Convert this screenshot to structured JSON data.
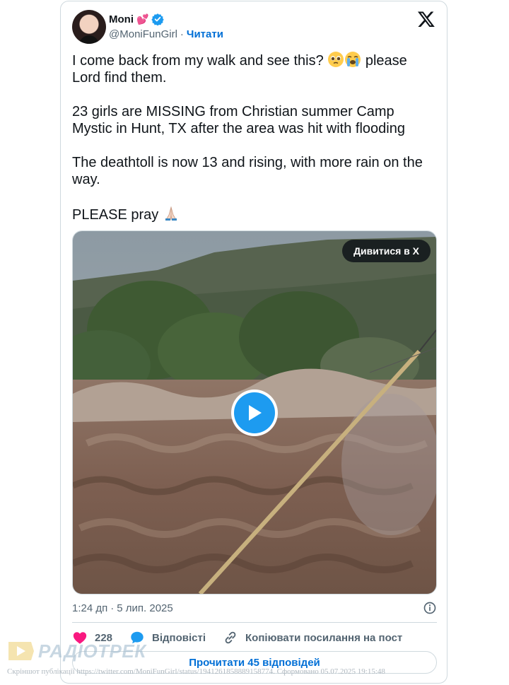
{
  "tweet": {
    "author_name": "Moni",
    "handle": "@MoniFunGirl",
    "separator": "·",
    "follow_label": "Читати",
    "paragraphs": {
      "p1a": "I come back from my walk and see this?",
      "p1b": "please Lord find them.",
      "p2": "23 girls are MISSING from Christian summer Camp Mystic in Hunt, TX after the area was hit with flooding",
      "p3": "The deathtoll is now 13 and rising, with more rain on the way.",
      "p4": "PLEASE pray"
    },
    "emojis": [
      "pleading-face",
      "loudly-crying-face",
      "folded-hands"
    ],
    "media": {
      "watch_label": "Дивитися в X",
      "type": "video"
    },
    "time": "1:24 дп",
    "date_sep": "·",
    "date": "5 лип. 2025",
    "likes_count": "228",
    "reply_label": "Відповісті",
    "copy_link_label": "Копіювати посилання на пост",
    "read_replies_label": "Прочитати 45 відповідей"
  },
  "watermark": {
    "brand": "РАДІОТРЕК",
    "caption": "Скріншот публікації https://twitter.com/MoniFunGirl/status/1941261858889158774. Сформовано 05.07.2025 19:15:48"
  },
  "colors": {
    "accent": "#1d9bf0",
    "link": "#006fd6",
    "like": "#f91880",
    "muted": "#536471",
    "border": "#cfd9de"
  }
}
